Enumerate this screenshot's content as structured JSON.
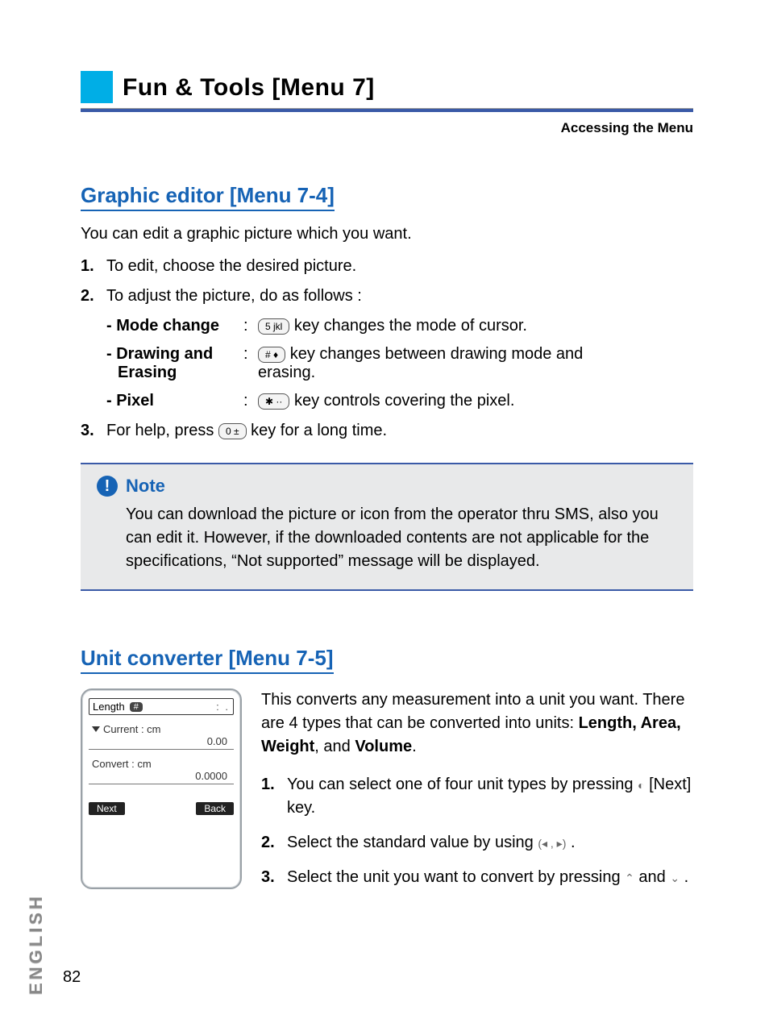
{
  "header": {
    "title": "Fun & Tools [Menu 7]",
    "subhead": "Accessing the Menu"
  },
  "section1": {
    "heading": "Graphic editor [Menu 7-4]",
    "intro": "You can edit a graphic picture which you want.",
    "step1_num": "1.",
    "step1": "To edit, choose the desired picture.",
    "step2_num": "2.",
    "step2": "To adjust the picture, do as follows :",
    "mode_label": "- Mode change",
    "mode_key": "5 jkl",
    "mode_text_after": " key changes the mode of cursor.",
    "draw_label1": "- Drawing and",
    "draw_label2": "Erasing",
    "draw_key": "# ♦",
    "draw_text_after1": " key changes between drawing mode and",
    "draw_text_after2": "erasing.",
    "pixel_label": "- Pixel",
    "pixel_key": "✱ ··",
    "pixel_text_after": " key controls covering the pixel.",
    "step3_num": "3.",
    "step3_before": "For help, press ",
    "step3_key": "0 ±",
    "step3_after": " key  for a long time."
  },
  "note": {
    "title": "Note",
    "body": "You can download the picture or icon from the operator thru SMS, also you can edit it. However, if the downloaded contents are not applicable for the specifications, “Not supported” message will be displayed."
  },
  "section2": {
    "heading": "Unit converter [Menu 7-5]",
    "intro_before": "This converts any measurement into a unit you want. There are 4 types that can be converted into units: ",
    "intro_bold": "Length, Area, Weight",
    "intro_mid": ", and ",
    "intro_bold2": "Volume",
    "intro_end": ".",
    "s1_num": "1.",
    "s1_before": "You can select one of four unit types by pressing ",
    "s1_after": " [Next] key.",
    "s2_num": "2.",
    "s2_before": "Select the standard value by using ",
    "s2_after": " .",
    "s3_num": "3.",
    "s3_before": "Select the unit you want to convert by pressing ",
    "s3_mid": " and ",
    "s3_after": " ."
  },
  "phone": {
    "tab": "Length",
    "hash": "#",
    "cur_label": "Current : cm",
    "cur_val": "0.00",
    "conv_label": "Convert : cm",
    "conv_val": "0.0000",
    "soft_left": "Next",
    "soft_right": "Back"
  },
  "side_label": "ENGLISH",
  "page_number": "82"
}
